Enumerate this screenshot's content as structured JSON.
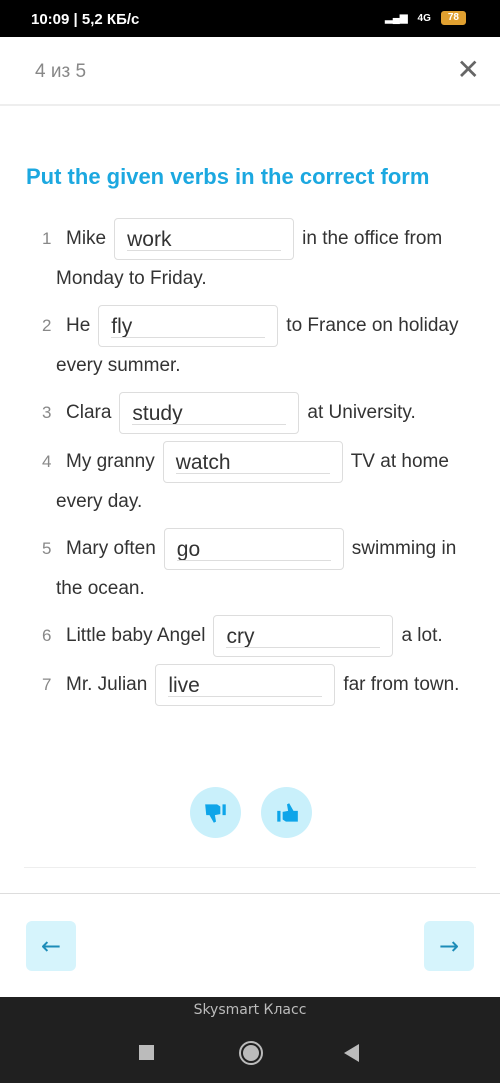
{
  "status_bar": {
    "time_speed": "10:09 | 5,2 КБ/с",
    "network": "4G",
    "battery": "78"
  },
  "header": {
    "counter": "4 из 5",
    "close_icon": "close-icon"
  },
  "exercise": {
    "title": "Put the given verbs in the correct form",
    "items": [
      {
        "num": "1",
        "before": "Mike",
        "value": "work",
        "after": "in the office from Monday to Friday."
      },
      {
        "num": "2",
        "before": "He",
        "value": "fly",
        "after": "to France on holiday every summer."
      },
      {
        "num": "3",
        "before": "Clara",
        "value": "study",
        "after": "at University."
      },
      {
        "num": "4",
        "before": "My granny",
        "value": "watch",
        "after": "TV at home every day."
      },
      {
        "num": "5",
        "before": "Mary often",
        "value": "go",
        "after": "swimming in the ocean."
      },
      {
        "num": "6",
        "before": "Little baby Angel",
        "value": "cry",
        "after": "a lot."
      },
      {
        "num": "7",
        "before": "Mr. Julian",
        "value": "live",
        "after": "far from town."
      }
    ]
  },
  "feedback": {
    "dislike_icon": "thumbs-down-icon",
    "like_icon": "thumbs-up-icon"
  },
  "navigation": {
    "prev_icon": "arrow-left-icon",
    "next_icon": "arrow-right-icon",
    "prev": "←",
    "next": "→"
  },
  "system": {
    "app_name": "Skysmart Класс"
  },
  "colors": {
    "accent": "#1ca8e0",
    "button_bg": "#c9f0fb"
  }
}
